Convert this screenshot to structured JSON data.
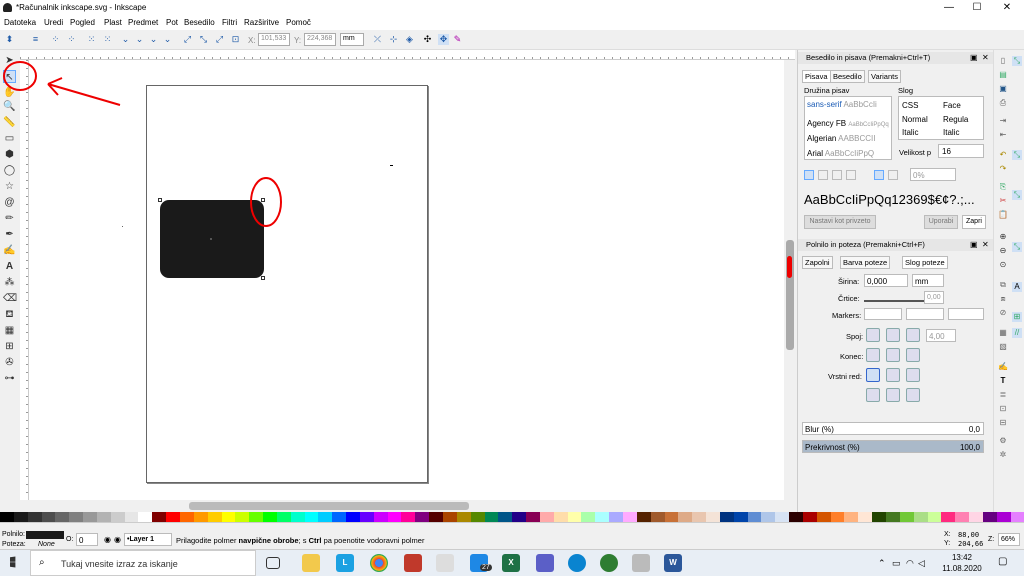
{
  "window": {
    "title": "*Računalnik inkscape.svg - Inkscape",
    "min": "—",
    "max": "☐",
    "close": "✕"
  },
  "menu": [
    "Datoteka",
    "Uredi",
    "Pogled",
    "Plast",
    "Predmet",
    "Pot",
    "Besedilo",
    "Filtri",
    "Razširitve",
    "Pomoč"
  ],
  "controls": {
    "x_label": "X:",
    "x_value": "101,533",
    "y_label": "Y:",
    "y_value": "224,368",
    "unit": "mm"
  },
  "tools": [
    "arrow",
    "node",
    "zoom",
    "measure",
    "rect",
    "3dbox",
    "ellipse",
    "star",
    "spiral",
    "pencil",
    "pen",
    "calligraphy",
    "text",
    "spray",
    "eraser",
    "bucket",
    "gradient",
    "mesh",
    "dropper",
    "connector"
  ],
  "text_panel": {
    "title": "Besedilo in pisava",
    "shortcut": "(Premakni+Ctrl+T)",
    "tabs": [
      "Pisava",
      "Besedilo",
      "Variants"
    ],
    "family_header": "Družina pisav",
    "style_header": "Slog",
    "fonts": [
      {
        "name": "sans-serif",
        "sample": "AaBbCcIi"
      },
      {
        "name": "Agency FB",
        "sample": "AaBbCcIiPpQq"
      },
      {
        "name": "Algerian",
        "sample": "AABBCCII"
      },
      {
        "name": "Arial",
        "sample": "AaBbCcIiPpQ"
      }
    ],
    "style_cols": [
      "CSS",
      "Face"
    ],
    "styles": [
      [
        "Normal",
        "Regula"
      ],
      [
        "Italic",
        "Italic"
      ]
    ],
    "size_label": "Velikost p",
    "size_value": "16",
    "spacing": "0%",
    "preview": "AaBbCcIiPpQq12369$€¢?.;...",
    "set_default": "Nastavi kot privzeto",
    "apply": "Uporabi",
    "close": "Zapri"
  },
  "fill_panel": {
    "title": "Polnilo in poteza",
    "shortcut": "(Premakni+Ctrl+F)",
    "tabs": [
      "Zapolni",
      "Barva poteze",
      "Slog poteze"
    ],
    "width_label": "Širina:",
    "width_value": "0,000",
    "width_unit": "mm",
    "dashes_label": "Črtice:",
    "dash_value": "0,00",
    "markers_label": "Markers:",
    "join_label": "Spoj:",
    "join_value": "4,00",
    "cap_label": "Konec:",
    "order_label": "Vrstni red:",
    "blur_label": "Blur (%)",
    "blur_value": "0,0",
    "opacity_label": "Prekrivnost (%)",
    "opacity_value": "100,0",
    "opacity": 1.0
  },
  "status": {
    "fill_label": "Polnilo:",
    "stroke_label": "Poteza:",
    "stroke_value": "None",
    "opacity_label": "O:",
    "opacity_value": "0",
    "layer": "•Layer 1",
    "message_pre": "Prilagodite polmer ",
    "message_bold": "navpične obrobe",
    "message_mid": "; s ",
    "message_ctrl": "Ctrl",
    "message_post": " pa poenotite vodoravni polmer",
    "x_label": "X:",
    "x_value": "88,00",
    "y_label": "Y:",
    "y_value": "204,66",
    "z_label": "Z:",
    "zoom": "66%"
  },
  "taskbar": {
    "search": "Tukaj vnesite izraz za iskanje",
    "badge": "27",
    "time": "13:42",
    "date": "11.08.2020"
  },
  "palette": [
    "#000000",
    "#1a1a1a",
    "#333",
    "#4d4d4d",
    "#666",
    "#808080",
    "#999",
    "#b3b3b3",
    "#ccc",
    "#e6e6e6",
    "#fff",
    "#800000",
    "#ff0000",
    "#ff6600",
    "#ff9900",
    "#ffcc00",
    "#ffff00",
    "#ccff00",
    "#66ff00",
    "#00ff00",
    "#00ff66",
    "#00ffcc",
    "#00ffff",
    "#00ccff",
    "#0066ff",
    "#0000ff",
    "#6600ff",
    "#cc00ff",
    "#ff00ff",
    "#ff0099",
    "#800080",
    "#550000",
    "#aa4400",
    "#aa8800",
    "#558800",
    "#008855",
    "#005588",
    "#220088",
    "#880055",
    "#ffaaaa",
    "#ffddaa",
    "#ffffaa",
    "#aaffaa",
    "#aaffff",
    "#aaaaff",
    "#ffaaff",
    "#552200",
    "#a05a2c",
    "#c87137",
    "#deaa87",
    "#e9c6af",
    "#f4e3d7",
    "#003380",
    "#0044aa",
    "#5f8dd3",
    "#afc6e9",
    "#d7e3f4",
    "#2b0000",
    "#aa0000",
    "#d45500",
    "#ff7f2a",
    "#ffb380",
    "#ffe6d5",
    "#224400",
    "#447821",
    "#71c837",
    "#aade87",
    "#ccff99",
    "#ff2a7f",
    "#ff80b2",
    "#ffd5e5",
    "#660080",
    "#aa00d4",
    "#e580ff"
  ]
}
